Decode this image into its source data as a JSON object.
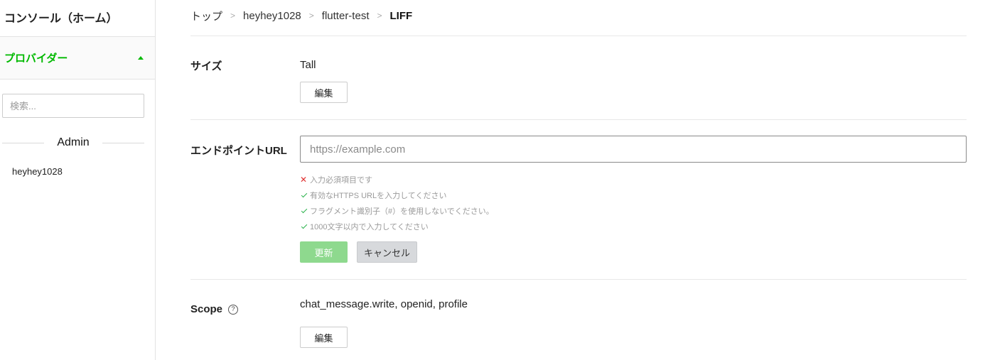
{
  "sidebar": {
    "home_label": "コンソール（ホーム）",
    "provider_label": "プロバイダー",
    "search_placeholder": "検索...",
    "section_title": "Admin",
    "account_item": "heyhey1028"
  },
  "breadcrumb": [
    "トップ",
    "heyhey1028",
    "flutter-test",
    "LIFF"
  ],
  "size": {
    "label": "サイズ",
    "value": "Tall",
    "edit_label": "編集"
  },
  "endpoint": {
    "label": "エンドポイントURL",
    "placeholder": "https://example.com",
    "value": "",
    "validations": [
      {
        "status": "error",
        "text": "入力必須項目です"
      },
      {
        "status": "ok",
        "text": "有効なHTTPS URLを入力してください"
      },
      {
        "status": "ok",
        "text": "フラグメント識別子（#）を使用しないでください。"
      },
      {
        "status": "ok",
        "text": "1000文字以内で入力してください"
      }
    ],
    "update_label": "更新",
    "cancel_label": "キャンセル"
  },
  "scope": {
    "label": "Scope",
    "help_symbol": "?",
    "value": "chat_message.write, openid, profile",
    "edit_label": "編集"
  },
  "colors": {
    "brand_green": "#00b900",
    "update_button": "#8ed98e",
    "error": "#e03030",
    "ok": "#2bb24c"
  }
}
